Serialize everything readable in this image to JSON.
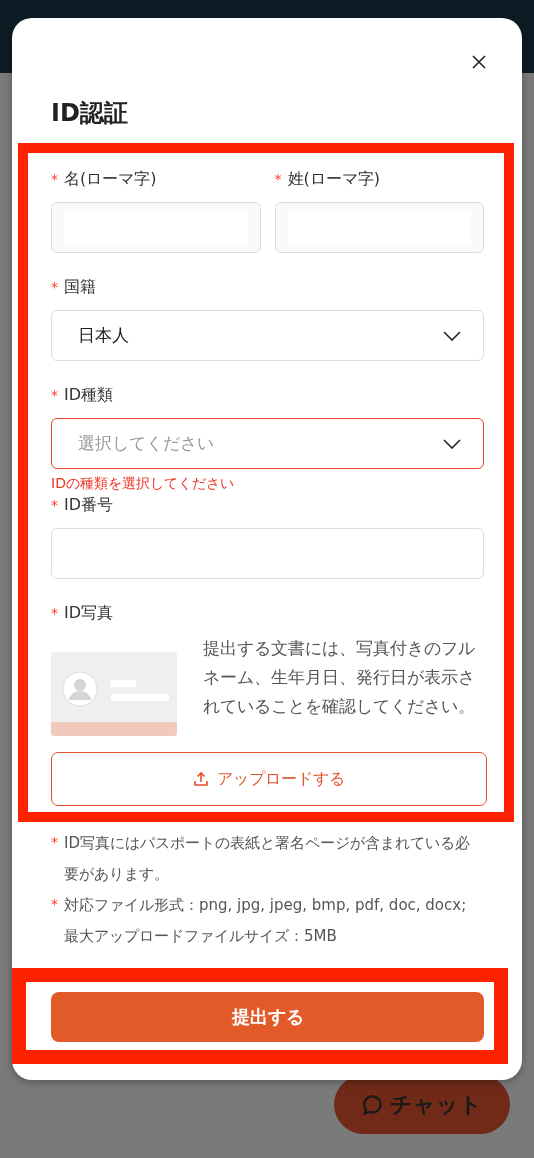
{
  "dialog": {
    "title": "ID認証"
  },
  "form": {
    "highlighted": true,
    "name_row": [
      {
        "label": "名(ローマ字)",
        "mark": "*"
      },
      {
        "label": "姓(ローマ字)",
        "mark": "*"
      }
    ],
    "fields": [
      {
        "kind": "select",
        "label": "国籍",
        "mark": "*",
        "value": "日本人",
        "invalid": false
      },
      {
        "kind": "select",
        "label": "ID種類",
        "mark": "*",
        "placeholder": "選択してください",
        "invalid": true,
        "error": "IDの種類を選択してください"
      },
      {
        "kind": "text",
        "label": "ID番号",
        "mark": "*",
        "invalid": false
      }
    ],
    "photo": {
      "label": "ID写真",
      "mark": "*",
      "description": "提出する文書には、写真付きのフルネーム、生年月日、発行日が表示されていることを確認してください。",
      "upload": "アップロードする"
    }
  },
  "notes": [
    {
      "mark": "*",
      "text": "ID写真にはパスポートの表紙と署名ページが含まれている必要があります。"
    },
    {
      "mark": "*",
      "text": "対応ファイル形式：png, jpg, jpeg, bmp, pdf, doc, docx; 最大アップロードファイルサイズ：5MB"
    }
  ],
  "submit": {
    "label": "提出する",
    "highlighted": true
  },
  "chat": {
    "label": "チャット"
  }
}
